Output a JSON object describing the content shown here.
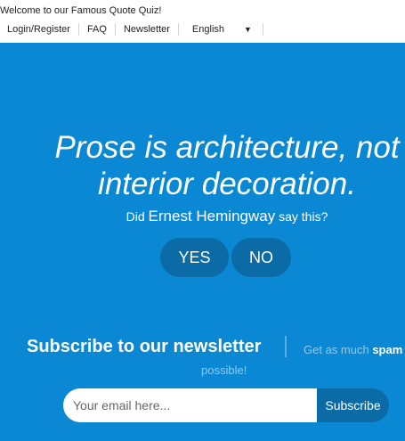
{
  "header": {
    "welcome": "Welcome to our Famous Quote Quiz!",
    "nav": [
      {
        "label": "Login/Register"
      },
      {
        "label": "FAQ"
      },
      {
        "label": "Newsletter"
      }
    ],
    "language": {
      "selected": "English",
      "caret": "▼"
    }
  },
  "quiz": {
    "quote_line1": "Prose is architecture, not",
    "quote_line2": "interior decoration.",
    "question_prefix": "Did",
    "author": "Ernest Hemingway",
    "question_suffix": "say this?",
    "yes_label": "YES",
    "no_label": "NO"
  },
  "newsletter": {
    "title": "Subscribe to our newsletter",
    "subtitle_prefix": "Get as much",
    "subtitle_bold": "spam",
    "subtitle_line2": "possible!",
    "email_placeholder": "Your email here...",
    "subscribe_label": "Subscribe"
  },
  "colors": {
    "hero_background": "#0b88d3",
    "button_background": "#0a6ba6",
    "text_on_blue": "#ffffff"
  }
}
